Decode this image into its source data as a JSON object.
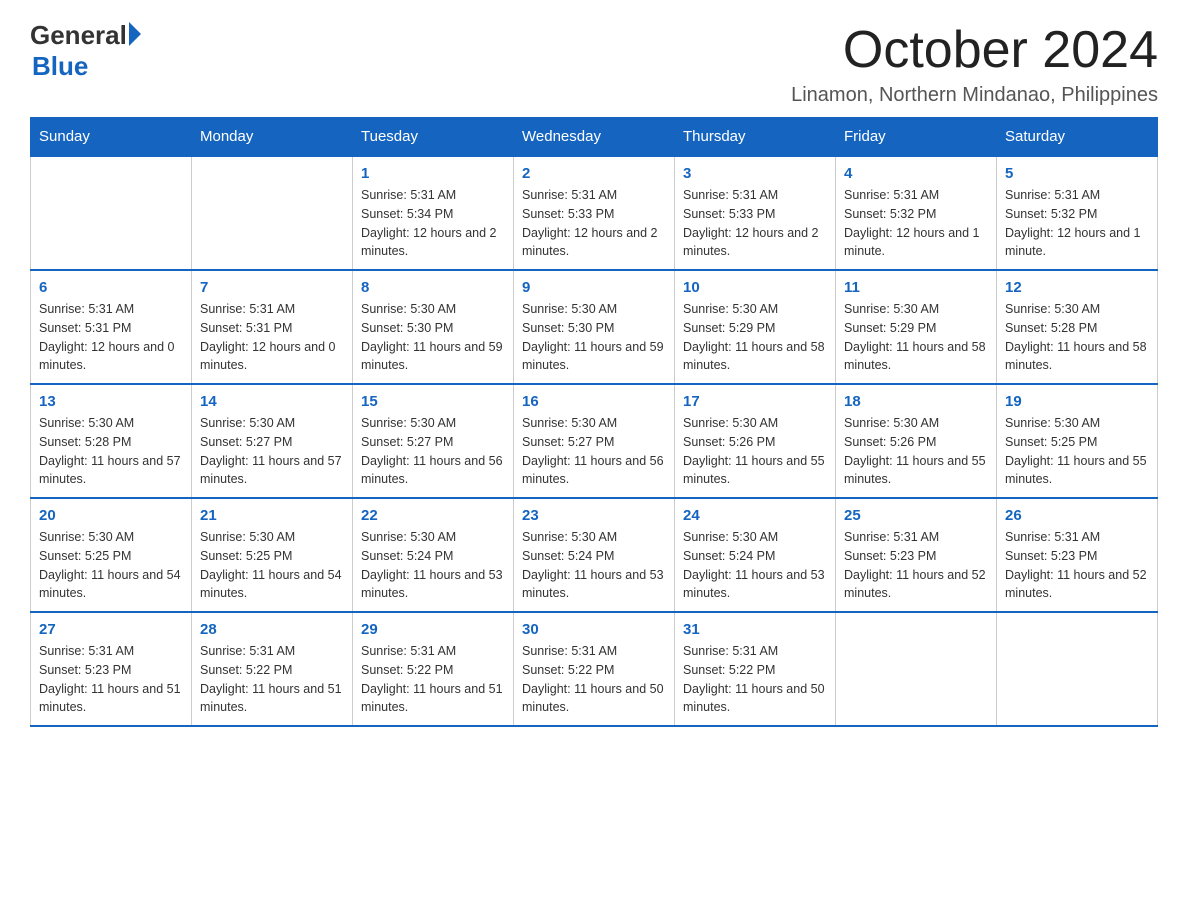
{
  "logo": {
    "general": "General",
    "blue": "Blue"
  },
  "title": "October 2024",
  "location": "Linamon, Northern Mindanao, Philippines",
  "days_of_week": [
    "Sunday",
    "Monday",
    "Tuesday",
    "Wednesday",
    "Thursday",
    "Friday",
    "Saturday"
  ],
  "weeks": [
    [
      {
        "day": "",
        "sunrise": "",
        "sunset": "",
        "daylight": ""
      },
      {
        "day": "",
        "sunrise": "",
        "sunset": "",
        "daylight": ""
      },
      {
        "day": "1",
        "sunrise": "Sunrise: 5:31 AM",
        "sunset": "Sunset: 5:34 PM",
        "daylight": "Daylight: 12 hours and 2 minutes."
      },
      {
        "day": "2",
        "sunrise": "Sunrise: 5:31 AM",
        "sunset": "Sunset: 5:33 PM",
        "daylight": "Daylight: 12 hours and 2 minutes."
      },
      {
        "day": "3",
        "sunrise": "Sunrise: 5:31 AM",
        "sunset": "Sunset: 5:33 PM",
        "daylight": "Daylight: 12 hours and 2 minutes."
      },
      {
        "day": "4",
        "sunrise": "Sunrise: 5:31 AM",
        "sunset": "Sunset: 5:32 PM",
        "daylight": "Daylight: 12 hours and 1 minute."
      },
      {
        "day": "5",
        "sunrise": "Sunrise: 5:31 AM",
        "sunset": "Sunset: 5:32 PM",
        "daylight": "Daylight: 12 hours and 1 minute."
      }
    ],
    [
      {
        "day": "6",
        "sunrise": "Sunrise: 5:31 AM",
        "sunset": "Sunset: 5:31 PM",
        "daylight": "Daylight: 12 hours and 0 minutes."
      },
      {
        "day": "7",
        "sunrise": "Sunrise: 5:31 AM",
        "sunset": "Sunset: 5:31 PM",
        "daylight": "Daylight: 12 hours and 0 minutes."
      },
      {
        "day": "8",
        "sunrise": "Sunrise: 5:30 AM",
        "sunset": "Sunset: 5:30 PM",
        "daylight": "Daylight: 11 hours and 59 minutes."
      },
      {
        "day": "9",
        "sunrise": "Sunrise: 5:30 AM",
        "sunset": "Sunset: 5:30 PM",
        "daylight": "Daylight: 11 hours and 59 minutes."
      },
      {
        "day": "10",
        "sunrise": "Sunrise: 5:30 AM",
        "sunset": "Sunset: 5:29 PM",
        "daylight": "Daylight: 11 hours and 58 minutes."
      },
      {
        "day": "11",
        "sunrise": "Sunrise: 5:30 AM",
        "sunset": "Sunset: 5:29 PM",
        "daylight": "Daylight: 11 hours and 58 minutes."
      },
      {
        "day": "12",
        "sunrise": "Sunrise: 5:30 AM",
        "sunset": "Sunset: 5:28 PM",
        "daylight": "Daylight: 11 hours and 58 minutes."
      }
    ],
    [
      {
        "day": "13",
        "sunrise": "Sunrise: 5:30 AM",
        "sunset": "Sunset: 5:28 PM",
        "daylight": "Daylight: 11 hours and 57 minutes."
      },
      {
        "day": "14",
        "sunrise": "Sunrise: 5:30 AM",
        "sunset": "Sunset: 5:27 PM",
        "daylight": "Daylight: 11 hours and 57 minutes."
      },
      {
        "day": "15",
        "sunrise": "Sunrise: 5:30 AM",
        "sunset": "Sunset: 5:27 PM",
        "daylight": "Daylight: 11 hours and 56 minutes."
      },
      {
        "day": "16",
        "sunrise": "Sunrise: 5:30 AM",
        "sunset": "Sunset: 5:27 PM",
        "daylight": "Daylight: 11 hours and 56 minutes."
      },
      {
        "day": "17",
        "sunrise": "Sunrise: 5:30 AM",
        "sunset": "Sunset: 5:26 PM",
        "daylight": "Daylight: 11 hours and 55 minutes."
      },
      {
        "day": "18",
        "sunrise": "Sunrise: 5:30 AM",
        "sunset": "Sunset: 5:26 PM",
        "daylight": "Daylight: 11 hours and 55 minutes."
      },
      {
        "day": "19",
        "sunrise": "Sunrise: 5:30 AM",
        "sunset": "Sunset: 5:25 PM",
        "daylight": "Daylight: 11 hours and 55 minutes."
      }
    ],
    [
      {
        "day": "20",
        "sunrise": "Sunrise: 5:30 AM",
        "sunset": "Sunset: 5:25 PM",
        "daylight": "Daylight: 11 hours and 54 minutes."
      },
      {
        "day": "21",
        "sunrise": "Sunrise: 5:30 AM",
        "sunset": "Sunset: 5:25 PM",
        "daylight": "Daylight: 11 hours and 54 minutes."
      },
      {
        "day": "22",
        "sunrise": "Sunrise: 5:30 AM",
        "sunset": "Sunset: 5:24 PM",
        "daylight": "Daylight: 11 hours and 53 minutes."
      },
      {
        "day": "23",
        "sunrise": "Sunrise: 5:30 AM",
        "sunset": "Sunset: 5:24 PM",
        "daylight": "Daylight: 11 hours and 53 minutes."
      },
      {
        "day": "24",
        "sunrise": "Sunrise: 5:30 AM",
        "sunset": "Sunset: 5:24 PM",
        "daylight": "Daylight: 11 hours and 53 minutes."
      },
      {
        "day": "25",
        "sunrise": "Sunrise: 5:31 AM",
        "sunset": "Sunset: 5:23 PM",
        "daylight": "Daylight: 11 hours and 52 minutes."
      },
      {
        "day": "26",
        "sunrise": "Sunrise: 5:31 AM",
        "sunset": "Sunset: 5:23 PM",
        "daylight": "Daylight: 11 hours and 52 minutes."
      }
    ],
    [
      {
        "day": "27",
        "sunrise": "Sunrise: 5:31 AM",
        "sunset": "Sunset: 5:23 PM",
        "daylight": "Daylight: 11 hours and 51 minutes."
      },
      {
        "day": "28",
        "sunrise": "Sunrise: 5:31 AM",
        "sunset": "Sunset: 5:22 PM",
        "daylight": "Daylight: 11 hours and 51 minutes."
      },
      {
        "day": "29",
        "sunrise": "Sunrise: 5:31 AM",
        "sunset": "Sunset: 5:22 PM",
        "daylight": "Daylight: 11 hours and 51 minutes."
      },
      {
        "day": "30",
        "sunrise": "Sunrise: 5:31 AM",
        "sunset": "Sunset: 5:22 PM",
        "daylight": "Daylight: 11 hours and 50 minutes."
      },
      {
        "day": "31",
        "sunrise": "Sunrise: 5:31 AM",
        "sunset": "Sunset: 5:22 PM",
        "daylight": "Daylight: 11 hours and 50 minutes."
      },
      {
        "day": "",
        "sunrise": "",
        "sunset": "",
        "daylight": ""
      },
      {
        "day": "",
        "sunrise": "",
        "sunset": "",
        "daylight": ""
      }
    ]
  ]
}
